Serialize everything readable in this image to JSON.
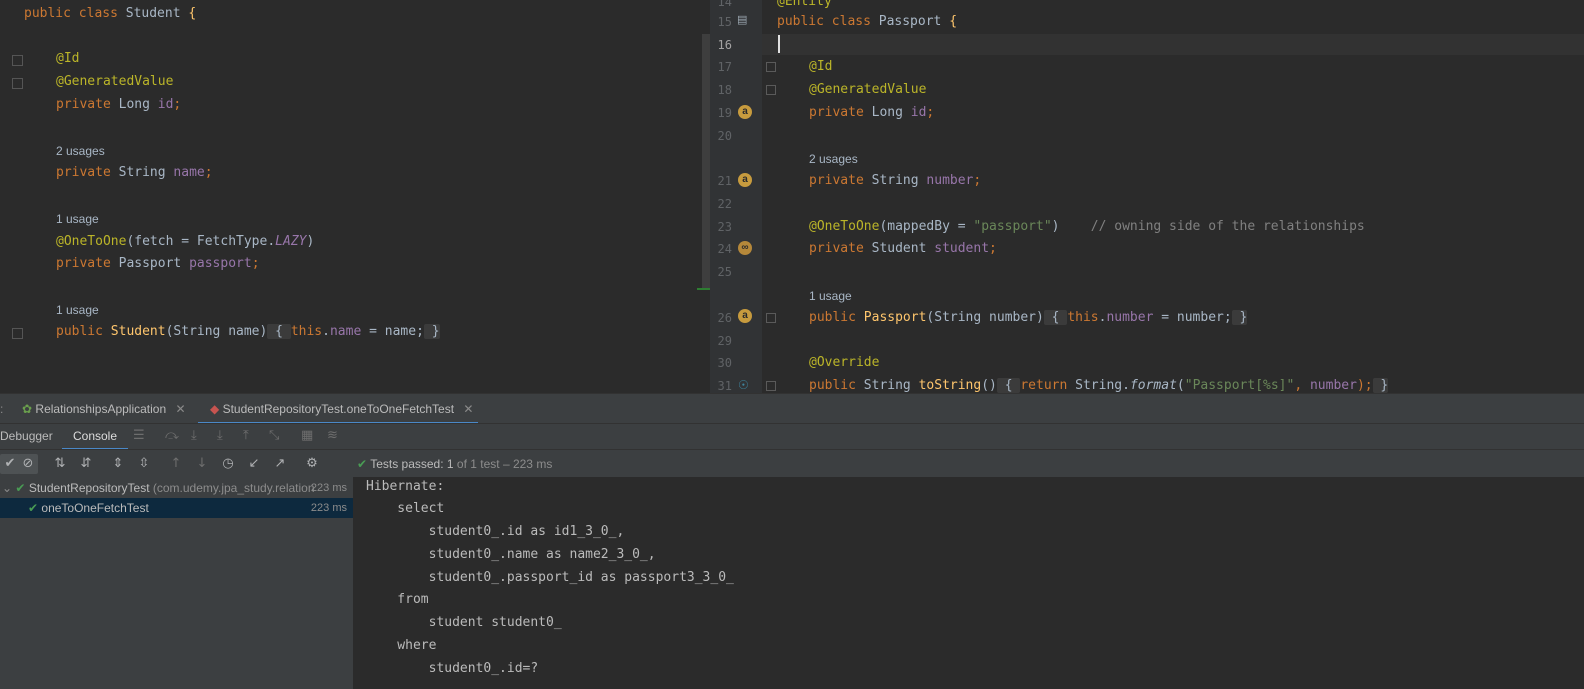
{
  "left_code": {
    "class_decl": {
      "kw": "public class ",
      "name": "Student",
      "brace": " {"
    },
    "id_annotation": "@Id",
    "gen_annotation": "@GeneratedValue",
    "id_field": {
      "kw": "private ",
      "type": "Long ",
      "name": "id",
      "end": ";"
    },
    "name_usages": "2 usages",
    "name_field": {
      "kw": "private ",
      "type": "String ",
      "name": "name",
      "end": ";"
    },
    "passport_usages": "1 usage",
    "onetoone": {
      "ann": "@OneToOne",
      "open": "(fetch = FetchType.",
      "lazy": "LAZY",
      "close": ")"
    },
    "passport_field": {
      "kw": "private ",
      "type": "Passport ",
      "name": "passport",
      "end": ";"
    },
    "ctor_usages": "1 usage",
    "ctor": {
      "kw": "public ",
      "name": "Student",
      "params": "(String name)",
      "open": " { ",
      "this": "this",
      "dot": ".",
      "field": "name",
      "assign": " = name;",
      "close": " }"
    }
  },
  "right_code": {
    "line_numbers": [
      "14",
      "15",
      "16",
      "17",
      "18",
      "19",
      "20",
      "21",
      "22",
      "23",
      "24",
      "25",
      "26",
      "29",
      "30",
      "31"
    ],
    "entity_annotation": "@Entity",
    "class_decl": {
      "kw": "public class ",
      "name": "Passport",
      "brace": " {"
    },
    "id_annotation": "@Id",
    "gen_annotation": "@GeneratedValue",
    "id_field": {
      "kw": "private ",
      "type": "Long ",
      "name": "id",
      "end": ";"
    },
    "number_usages": "2 usages",
    "number_field": {
      "kw": "private ",
      "type": "String ",
      "name": "number",
      "end": ";"
    },
    "onetoone": {
      "ann": "@OneToOne",
      "open": "(mappedBy = ",
      "str": "\"passport\"",
      "close": ")",
      "comment": "    // owning side of the relationships"
    },
    "student_field": {
      "kw": "private ",
      "type": "Student ",
      "name": "student",
      "end": ";"
    },
    "ctor_usages": "1 usage",
    "ctor": {
      "kw": "public ",
      "name": "Passport",
      "params": "(String number)",
      "open": " { ",
      "this": "this",
      "dot": ".",
      "field": "number",
      "assign": " = number;",
      "close": " }"
    },
    "override": "@Override",
    "tostring": {
      "kw": "public ",
      "type": "String ",
      "name": "toString",
      "parens": "()",
      "open": " { ",
      "ret": "return ",
      "cls": "String.",
      "fmt": "format",
      "args_open": "(",
      "str": "\"Passport[%s]\"",
      "comma": ", ",
      "field": "number",
      "args_close": ");",
      "close": " }"
    }
  },
  "run_tabs": {
    "prefix": ":",
    "app_tab": "RelationshipsApplication",
    "test_tab": "StudentRepositoryTest.oneToOneFetchTest"
  },
  "sub_tabs": {
    "debugger": "Debugger",
    "console": "Console"
  },
  "test_status": {
    "passed_label": "Tests passed: ",
    "passed_count": "1",
    "of_total": " of 1 test – 223 ms"
  },
  "test_tree": {
    "suite": {
      "name": "StudentRepositoryTest",
      "package": " (com.udemy.jpa_study.relation",
      "duration": "223 ms"
    },
    "test": {
      "name": "oneToOneFetchTest",
      "duration": "223 ms"
    }
  },
  "console_lines": [
    "Hibernate: ",
    "    select",
    "        student0_.id as id1_3_0_,",
    "        student0_.name as name2_3_0_,",
    "        student0_.passport_id as passport3_3_0_ ",
    "    from",
    "        student student0_ ",
    "    where",
    "        student0_.id=?"
  ],
  "colors": {
    "keyword": "#cc7832",
    "annotation": "#bbb529",
    "field": "#9876aa",
    "method": "#ffc66d",
    "string": "#6a8759",
    "pass": "#499c54",
    "accent": "#4a88c7"
  }
}
